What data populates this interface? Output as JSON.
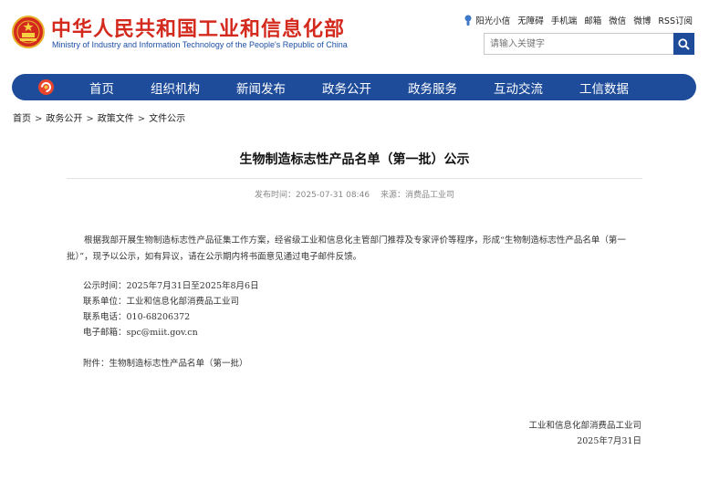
{
  "header": {
    "site_name": "中华人民共和国工业和信息化部",
    "site_name_en": "Ministry of Industry and Information Technology of the People's Republic of China",
    "brand_color": "#d42a1e",
    "accent_color": "#1e4c9a",
    "top_links": [
      "阳光小信",
      "无障碍",
      "手机端",
      "邮箱",
      "微信",
      "微博",
      "RSS订阅"
    ],
    "search": {
      "placeholder": "请输入关键字",
      "value": ""
    }
  },
  "nav": {
    "items": [
      "首页",
      "组织机构",
      "新闻发布",
      "政务公开",
      "政务服务",
      "互动交流",
      "工信数据"
    ]
  },
  "breadcrumb": [
    "首页",
    "政务公开",
    "政策文件",
    "文件公示"
  ],
  "breadcrumb_separator": ">",
  "article": {
    "title": "生物制造标志性产品名单（第一批）公示",
    "publish_label": "发布时间：2025-07-31 08:46",
    "source_label": "来源：消费品工业司",
    "paragraph": "根据我部开展生物制造标志性产品征集工作方案，经省级工业和信息化主管部门推荐及专家评价等程序，形成“生物制造标志性产品名单（第一批）”，现予以公示，如有异议，请在公示期内将书面意见通过电子邮件反馈。",
    "info": [
      "公示时间：2025年7月31日至2025年8月6日",
      "联系单位：工业和信息化部消费品工业司",
      "联系电话：010-68206372",
      "电子邮箱：spc@miit.gov.cn"
    ],
    "attachment": "附件：生物制造标志性产品名单（第一批）",
    "signature_org": "工业和信息化部消费品工业司",
    "signature_date": "2025年7月31日"
  }
}
